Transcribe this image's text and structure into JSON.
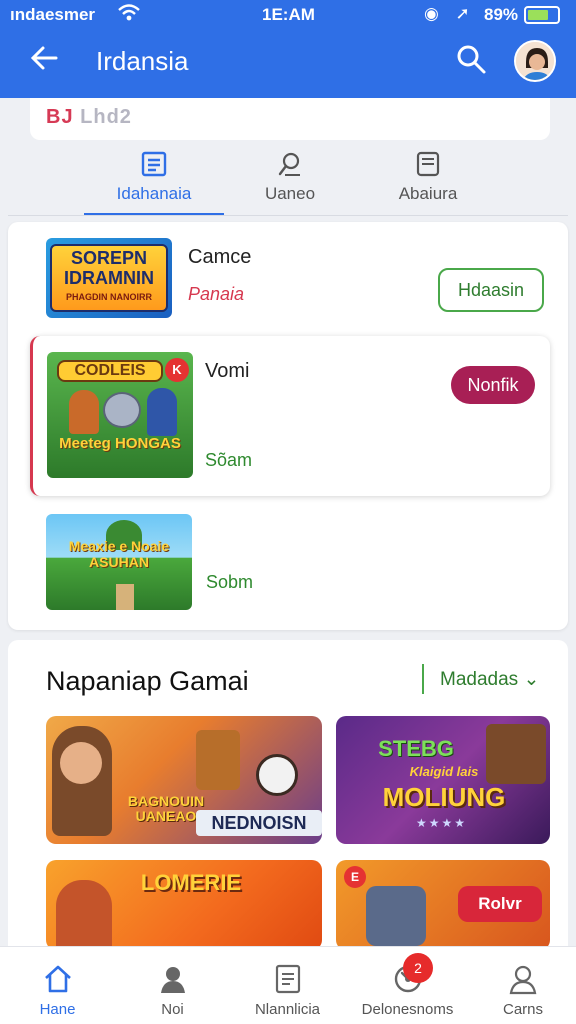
{
  "status_bar": {
    "carrier": "ındaesmer",
    "time": "1E:AM",
    "battery": "89%",
    "battery_level": 0.7
  },
  "app_bar": {
    "title": "Irdansia"
  },
  "brand": {
    "logo_prefix": "BJ",
    "logo_text": "Lhd2"
  },
  "tabs": [
    {
      "label": "Idahanaia",
      "icon": "list-icon",
      "active": true
    },
    {
      "label": "Uaneo",
      "icon": "search-person-icon",
      "active": false
    },
    {
      "label": "Abaiura",
      "icon": "document-icon",
      "active": false
    }
  ],
  "list_items": [
    {
      "name": "Camce",
      "sub": "Panaia",
      "button": "Hdaasin",
      "thumb_text": "SOREPN IDRAMNIN",
      "thumb_sub": "PHAGDIN NANOIRR"
    },
    {
      "name": "Vomi",
      "sub": "Sõam",
      "button": "Nonfik",
      "thumb_text": "CODLEIS",
      "thumb_sub": "Meeteg HONGAS",
      "thumb_badge": "K"
    },
    {
      "name": "",
      "sub": "Sobm",
      "thumb_text": "Meaxie e Noaie ASUHAN"
    }
  ],
  "section": {
    "heading": "Napaniap Gamai",
    "more_label": "Madadas",
    "cards": [
      {
        "title": "BAGNOUIN UANEAO",
        "subtitle": "NEDNOISN"
      },
      {
        "title": "STEBG",
        "subtitle": "MOLIUNG",
        "tagline": "Klaigid lais"
      },
      {
        "title": "LOMERIE"
      },
      {
        "title": "Rolvr",
        "badge": "E"
      }
    ]
  },
  "bottom_nav": [
    {
      "label": "Hane",
      "icon": "home-icon",
      "active": true
    },
    {
      "label": "Noi",
      "icon": "person-icon",
      "active": false
    },
    {
      "label": "Nlannlicia",
      "icon": "document-icon",
      "active": false
    },
    {
      "label": "Delonesnoms",
      "icon": "gauge-icon",
      "active": false,
      "badge": "2"
    },
    {
      "label": "Carns",
      "icon": "user-icon",
      "active": false
    }
  ]
}
